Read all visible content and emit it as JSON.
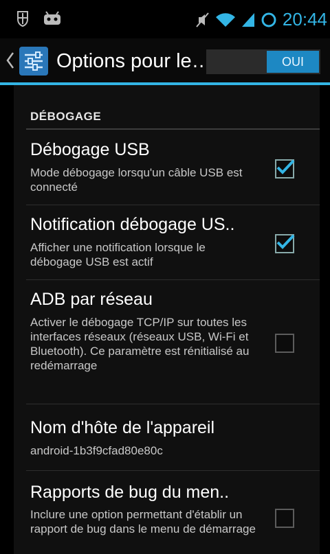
{
  "status_bar": {
    "time": "20:44",
    "left_icons": [
      "usb-debug-icon",
      "android-icon"
    ],
    "right_icons": [
      "mute-icon",
      "wifi-icon",
      "signal-icon",
      "sync-icon"
    ],
    "accent": "#33b5e5"
  },
  "action_bar": {
    "title": "Options pour le…",
    "switch_label": "OUI",
    "accent": "#33b5e5"
  },
  "section": {
    "header": "DÉBOGAGE"
  },
  "prefs": [
    {
      "title": "Débogage USB",
      "summary": "Mode débogage lorsqu'un câble USB est connecté",
      "checked": true
    },
    {
      "title": "Notification débogage US..",
      "summary": "Afficher une notification lorsque le débogage USB est actif",
      "checked": true
    },
    {
      "title": "ADB par réseau",
      "summary": "Activer le débogage TCP/IP sur toutes les interfaces réseaux (réseaux USB, Wi-Fi et Bluetooth). Ce paramètre est rénitialisé au redémarrage",
      "checked": false
    },
    {
      "title": "Nom d'hôte de l'appareil",
      "summary": "android-1b3f9cfad80e80c"
    },
    {
      "title": "Rapports de bug du men..",
      "summary": "Inclure une option permettant d'établir un rapport de bug dans le menu de démarrage",
      "checked": false
    }
  ]
}
